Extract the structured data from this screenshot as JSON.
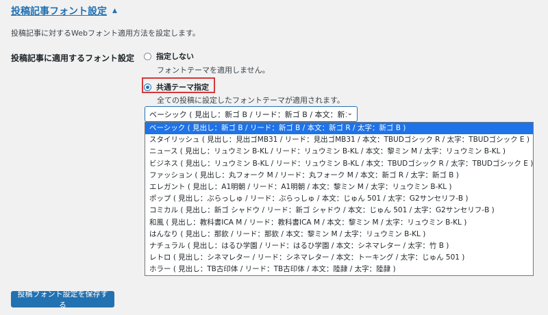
{
  "section": {
    "title": "投稿記事フォント設定",
    "toggle_icon": "triangle-up-icon",
    "description": "投稿記事に対するWebフォント適用方法を設定します。"
  },
  "setting": {
    "label": "投稿記事に適用するフォント設定",
    "options": [
      {
        "label": "指定しない",
        "sub": "フォントテーマを適用しません。",
        "checked": false
      },
      {
        "label": "共通テーマ指定",
        "sub": "全ての投稿に設定したフォントテーマが適用されます。",
        "checked": true
      }
    ],
    "select": {
      "value": "ベーシック ( 見出し：新ゴ B / リード：新ゴ B / 本文：新ゴ R / 太字：新ゴ B )",
      "options": [
        "ベーシック ( 見出し：新ゴ B / リード：新ゴ B / 本文：新ゴ R / 太字：新ゴ B )",
        "スタイリッシュ ( 見出し：見出ゴMB31 / リード：見出ゴMB31 / 本文：TBUDゴシック R / 太字：TBUDゴシック E )",
        "ニュース ( 見出し：リュウミン B-KL / リード：リュウミン B-KL / 本文：黎ミン M / 太字：リュウミン B-KL )",
        "ビジネス ( 見出し：リュウミン B-KL / リード：リュウミン B-KL / 本文：TBUDゴシック R / 太字：TBUDゴシック E )",
        "ファッション ( 見出し：丸フォーク M / リード：丸フォーク M / 本文：新ゴ R / 太字：新ゴ B )",
        "エレガント ( 見出し：A1明朝 / リード：A1明朝 / 本文：黎ミン M / 太字：リュウミン B-KL )",
        "ポップ ( 見出し：ぶらっしゅ / リード：ぶらっしゅ / 本文：じゅん 501 / 太字：G2サンセリフ-B )",
        "コミカル ( 見出し：新ゴ シャドウ / リード：新ゴ シャドウ / 本文：じゅん 501 / 太字：G2サンセリフ-B )",
        "和風 ( 見出し：教科書ICA M / リード：教科書ICA M / 本文：黎ミン M / 太字：リュウミン B-KL )",
        "はんなり ( 見出し：那欽 / リード：那欽 / 本文：黎ミン M / 太字：リュウミン B-KL )",
        "ナチュラル ( 見出し：はるひ学園 / リード：はるひ学園 / 本文：シネマレター / 太字：竹 B )",
        "レトロ ( 見出し：シネマレター / リード：シネマレター / 本文：トーキング / 太字：じゅん 501 )",
        "ホラー ( 見出し：TB古印体 / リード：TB古印体 / 本文：陸隷 / 太字：陸隷 )"
      ],
      "selected_index": 0
    }
  },
  "save_button": "投稿フォント設定を保存する"
}
